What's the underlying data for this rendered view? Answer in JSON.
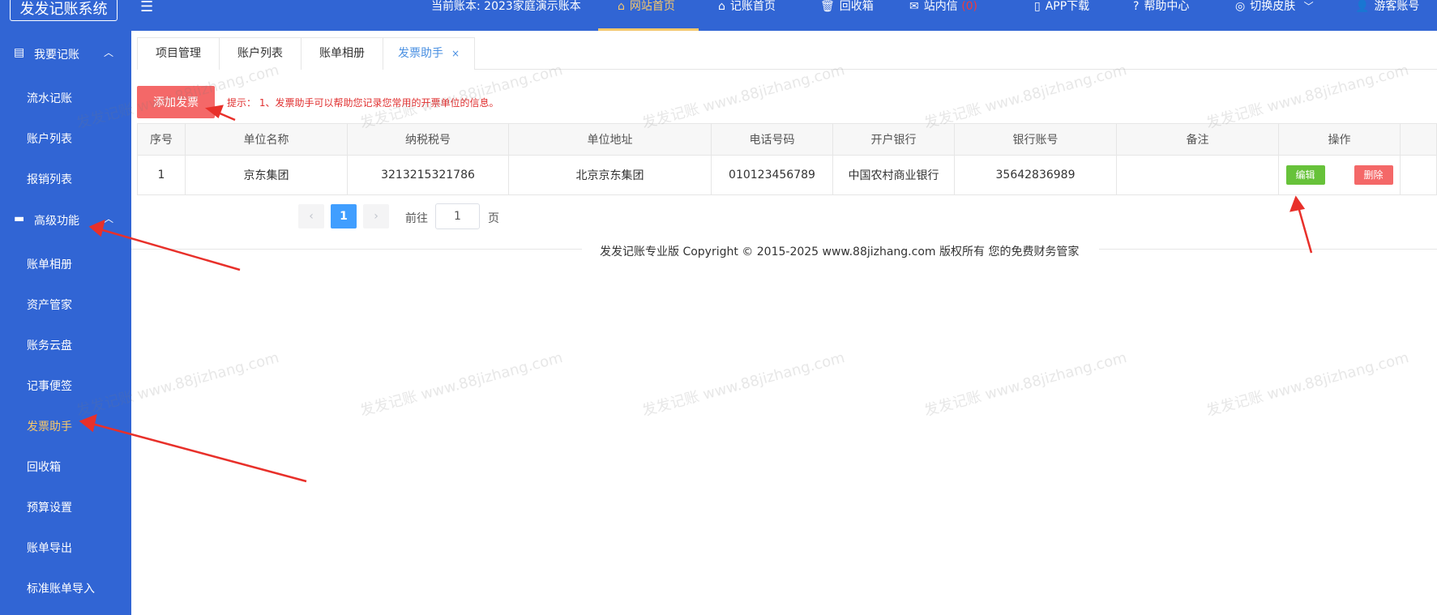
{
  "header": {
    "logo": "发发记账系统",
    "menu_toggle": "☰",
    "account": "当前账本: 2023家庭演示账本",
    "nav": [
      {
        "icon": "home-icon",
        "glyph": "⌂",
        "label": "网站首页"
      },
      {
        "icon": "home-icon",
        "glyph": "⌂",
        "label": "记账首页"
      },
      {
        "icon": "trash-icon",
        "glyph": "🗑",
        "label": "回收箱"
      },
      {
        "icon": "mail-icon",
        "glyph": "✉",
        "label": "站内信"
      },
      {
        "icon": "phone-icon",
        "glyph": "▯",
        "label": "APP下载"
      },
      {
        "icon": "help-icon",
        "glyph": "?",
        "label": "帮助中心"
      },
      {
        "icon": "skin-icon",
        "glyph": "◎",
        "label": "切换皮肤"
      },
      {
        "icon": "user-icon",
        "glyph": "👤",
        "label": "游客账号"
      }
    ],
    "message_count": "(0)",
    "chevron": "﹀"
  },
  "sidebar": {
    "groups": [
      {
        "label": "我要记账",
        "icon": "ledger-icon",
        "glyph": "▤",
        "chevron": "︿"
      },
      {
        "label": "高级功能",
        "icon": "briefcase-icon",
        "glyph": "▬",
        "chevron": "︿"
      }
    ],
    "items": [
      "流水记账",
      "账户列表",
      "报销列表",
      "账单相册",
      "资产管家",
      "账务云盘",
      "记事便签",
      "发票助手",
      "回收箱",
      "预算设置",
      "账单导出",
      "标准账单导入"
    ]
  },
  "tabs": [
    {
      "label": "项目管理"
    },
    {
      "label": "账户列表"
    },
    {
      "label": "账单相册"
    },
    {
      "label": "发票助手",
      "close": "×"
    }
  ],
  "toolbar": {
    "add_label": "添加发票",
    "hint": "提示：  1、发票助手可以帮助您记录您常用的开票单位的信息。"
  },
  "table": {
    "headers": [
      "序号",
      "单位名称",
      "纳税税号",
      "单位地址",
      "电话号码",
      "开户银行",
      "银行账号",
      "备注",
      "操作"
    ],
    "rows": [
      {
        "index": "1",
        "name": "京东集团",
        "tax_id": "3213215321786",
        "address": "北京京东集团",
        "phone": "010123456789",
        "bank": "中国农村商业银行",
        "account": "35642836989",
        "note": "",
        "edit": "编辑",
        "delete": "删除"
      }
    ]
  },
  "pagination": {
    "prev": "‹",
    "current": "1",
    "next": "›",
    "goto_label": "前往",
    "goto_value": "1",
    "suffix": "页"
  },
  "footer": {
    "text": "发发记账专业版  Copyright © 2015-2025 www.88jizhang.com 版权所有   您的免费财务管家"
  },
  "watermark": "发发记账 www.88jizhang.com",
  "colors": {
    "primary": "#3165d4",
    "active": "#f7c86a",
    "danger": "#f46868",
    "success": "#67c23a",
    "link": "#409eff"
  }
}
